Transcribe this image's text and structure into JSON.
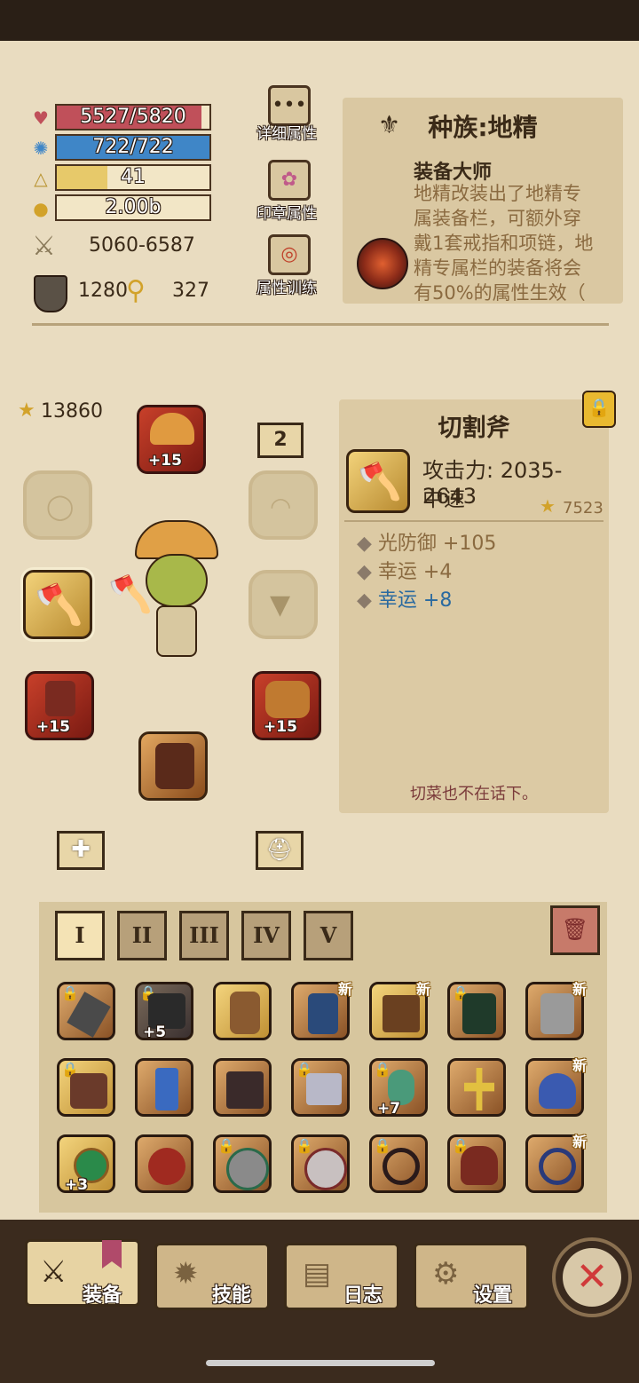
{
  "stats": {
    "hp": "5527/5820",
    "mp": "722/722",
    "level": "41",
    "gold": "2.00b",
    "attack": "5060-6587",
    "defense": "1280",
    "luck": "327"
  },
  "side_buttons": {
    "detail": "详细属性",
    "seal": "印章属性",
    "training": "属性训练"
  },
  "race": {
    "title": "种族:地精",
    "skill_name": "装备大师",
    "description": "地精改装出了地精专属装备栏，可额外穿戴1套戒指和项链，地精专属栏的装备将会有50%的属性生效（"
  },
  "character": {
    "rating": "13860",
    "slot_page": "2",
    "helmet_plus": "+15",
    "left_boot_plus": "+15",
    "right_boot_plus": "+15"
  },
  "item": {
    "name": "切割斧",
    "attack": "攻击力: 2035-2643",
    "speed": "中速",
    "rating": "7523",
    "attributes": [
      {
        "text": "光防御 +105"
      },
      {
        "text": "幸运 +4"
      },
      {
        "text": "幸运 +8"
      }
    ],
    "flavor": "切菜也不在话下。"
  },
  "tabs": [
    "I",
    "II",
    "III",
    "IV",
    "V"
  ],
  "inventory": {
    "new_label": "新",
    "badges": [
      "+5",
      "+7",
      "+3"
    ]
  },
  "nav": {
    "equipment": "装备",
    "skills": "技能",
    "log": "日志",
    "settings": "设置"
  },
  "colors": {
    "hp": "#c0505a",
    "mp": "#3f86c7",
    "level": "#e7c96a",
    "accent_blue": "#2a6aa0"
  }
}
